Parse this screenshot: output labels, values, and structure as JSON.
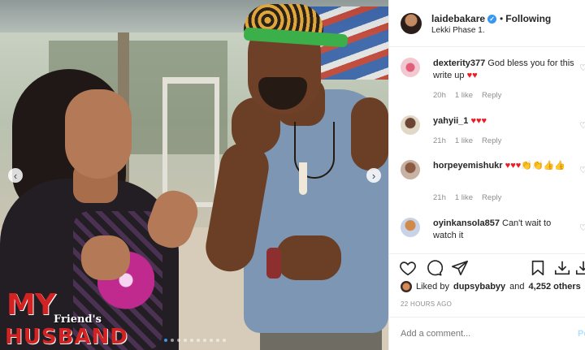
{
  "photo": {
    "title_line1": "MY",
    "title_line2": "Friend's",
    "title_line3": "HUSBAND",
    "prev_icon": "‹",
    "next_icon": "›",
    "slide_count": 10,
    "active_slide": 1
  },
  "header": {
    "username": "laidebakare",
    "verified_icon": "✓",
    "separator": "•",
    "follow_status": "Following",
    "location": "Lekki Phase 1."
  },
  "comments": [
    {
      "username": "dexterity377",
      "text": "God bless you for this write up",
      "emoji": "♥♥",
      "time": "20h",
      "likes": "1 like",
      "reply": "Reply",
      "avatar_color": "#f3c9d1"
    },
    {
      "username": "yahyii_1",
      "text": "",
      "emoji": "♥♥♥",
      "time": "21h",
      "likes": "1 like",
      "reply": "Reply",
      "avatar_color": "#d9cdbd"
    },
    {
      "username": "horpeyemishukr",
      "text": "",
      "emoji": "♥♥♥👏👏👍👍",
      "time": "21h",
      "likes": "1 like",
      "reply": "Reply",
      "avatar_color": "#b99b8a"
    },
    {
      "username": "oyinkansola857",
      "text": "Can't wait to watch it",
      "emoji": "",
      "time": "",
      "likes": "",
      "reply": "",
      "avatar_color": "#c8d3e8"
    }
  ],
  "comment_like_icon": "♡",
  "likes": {
    "prefix": "Liked by",
    "user": "dupsybabyy",
    "connector": "and",
    "others": "4,252 others"
  },
  "timestamp": "22 HOURS AGO",
  "add_comment": {
    "placeholder": "Add a comment...",
    "post_label": "Post"
  },
  "colors": {
    "accent": "#3897f0",
    "heart": "#ed1c24",
    "muted": "#8e8e8e",
    "title_red": "#d32222"
  }
}
